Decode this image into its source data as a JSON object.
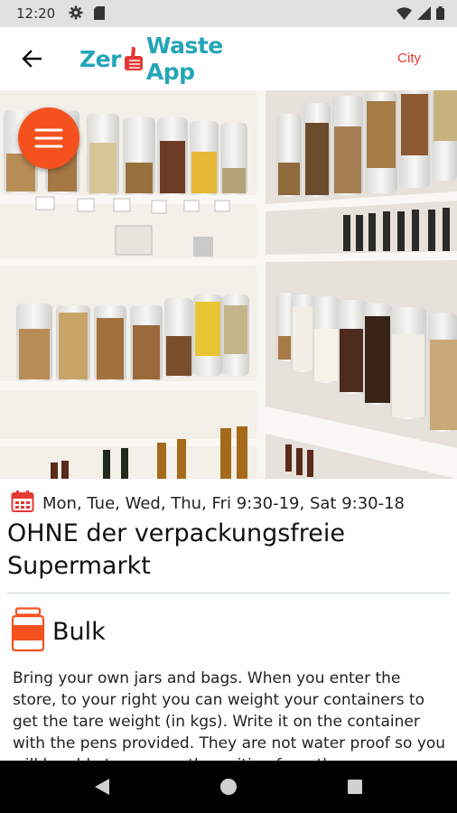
{
  "status_bar": {
    "time": "12:20",
    "icons": [
      "gear-icon",
      "sd-card-icon",
      "wifi-icon",
      "signal-icon",
      "battery-icon"
    ]
  },
  "app_bar": {
    "logo_part1": "Zer",
    "logo_part2": "Waste App",
    "logo_colors": {
      "teal": "#25a5b7",
      "red": "#e53935"
    },
    "city_label": "City"
  },
  "hero": {
    "image": "zero-waste-shop-bulk-dispensers-photo"
  },
  "shop": {
    "hours": "Mon, Tue, Wed, Thu, Fri 9:30-19, Sat 9:30-18",
    "name": "OHNE der verpackungsfreie Supermarkt"
  },
  "category": {
    "label": "Bulk",
    "description": "Bring your own jars and bags. When you enter the store, to your right you can weight your containers to get the tare weight (in kgs). Write it on the container with the pens provided. They are not water proof so you will be able to remove the writing from the"
  },
  "colors": {
    "accent": "#f4511e",
    "text": "#111111",
    "divider": "#c9d4dc"
  }
}
